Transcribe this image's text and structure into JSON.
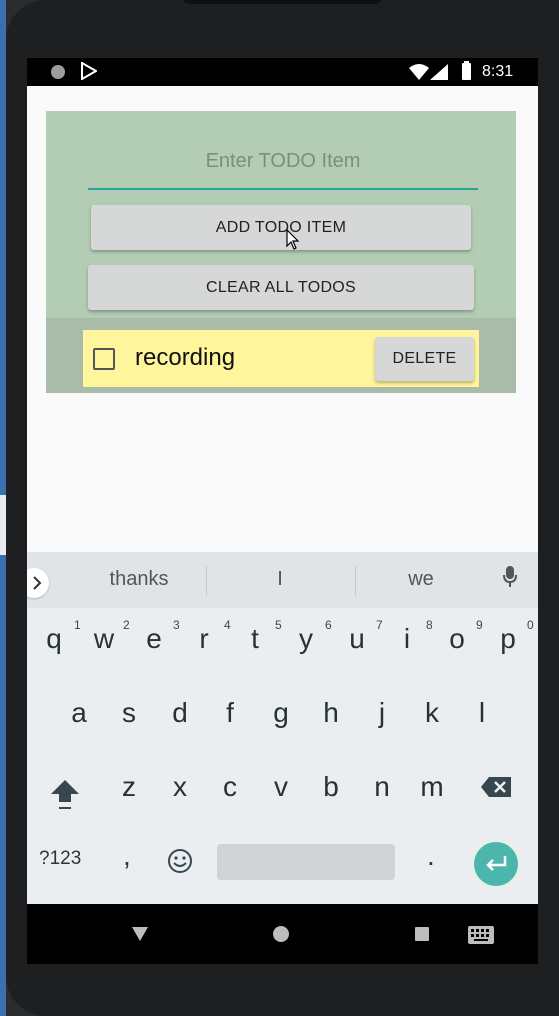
{
  "status_bar": {
    "time": "8:31"
  },
  "app": {
    "input_placeholder": "Enter TODO Item",
    "add_button": "ADD TODO ITEM",
    "clear_button": "CLEAR ALL TODOS",
    "todos": [
      {
        "text": "recording",
        "checked": false,
        "delete_label": "DELETE"
      }
    ]
  },
  "keyboard": {
    "suggestions": [
      "thanks",
      "I",
      "we"
    ],
    "row1": [
      "q",
      "w",
      "e",
      "r",
      "t",
      "y",
      "u",
      "i",
      "o",
      "p"
    ],
    "row1_hints": [
      "1",
      "2",
      "3",
      "4",
      "5",
      "6",
      "7",
      "8",
      "9",
      "0"
    ],
    "row2": [
      "a",
      "s",
      "d",
      "f",
      "g",
      "h",
      "j",
      "k",
      "l"
    ],
    "row3": [
      "z",
      "x",
      "c",
      "v",
      "b",
      "n",
      "m"
    ],
    "symbols_key": "?123",
    "comma": ",",
    "period": ".",
    "icons": [
      "chevron-right-icon",
      "mic-icon",
      "shift-icon",
      "backspace-icon",
      "emoji-icon",
      "enter-icon"
    ]
  },
  "colors": {
    "accent": "#26a69a",
    "app_bg": "#b3cdb4",
    "todo_bg": "#fff59d",
    "enter": "#4db6ac"
  }
}
